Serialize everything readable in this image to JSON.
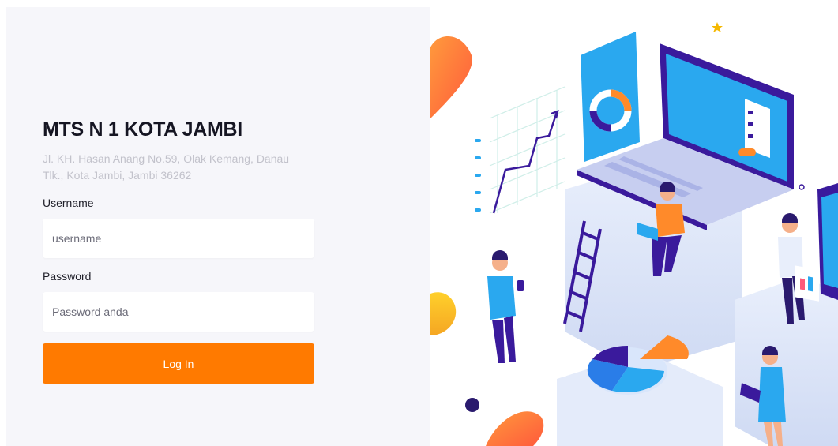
{
  "school": {
    "name": "MTS N 1 KOTA JAMBI",
    "address": "Jl. KH. Hasan Anang No.59, Olak Kemang, Danau Tlk., Kota Jambi, Jambi 36262"
  },
  "form": {
    "username_label": "Username",
    "username_placeholder": "username",
    "username_value": "",
    "password_label": "Password",
    "password_placeholder": "Password anda",
    "password_value": "",
    "login_label": "Log In"
  },
  "colors": {
    "accent": "#ff7a00",
    "panel_bg": "#f6f6fa",
    "illustration_blue": "#33b3f3",
    "illustration_purple": "#3a1a9c"
  },
  "illustration": {
    "icons": [
      "star-icon",
      "laptop-icon",
      "phone-icon",
      "ladder-icon",
      "pie-chart-icon",
      "line-chart-icon",
      "donut-chart-icon"
    ]
  }
}
